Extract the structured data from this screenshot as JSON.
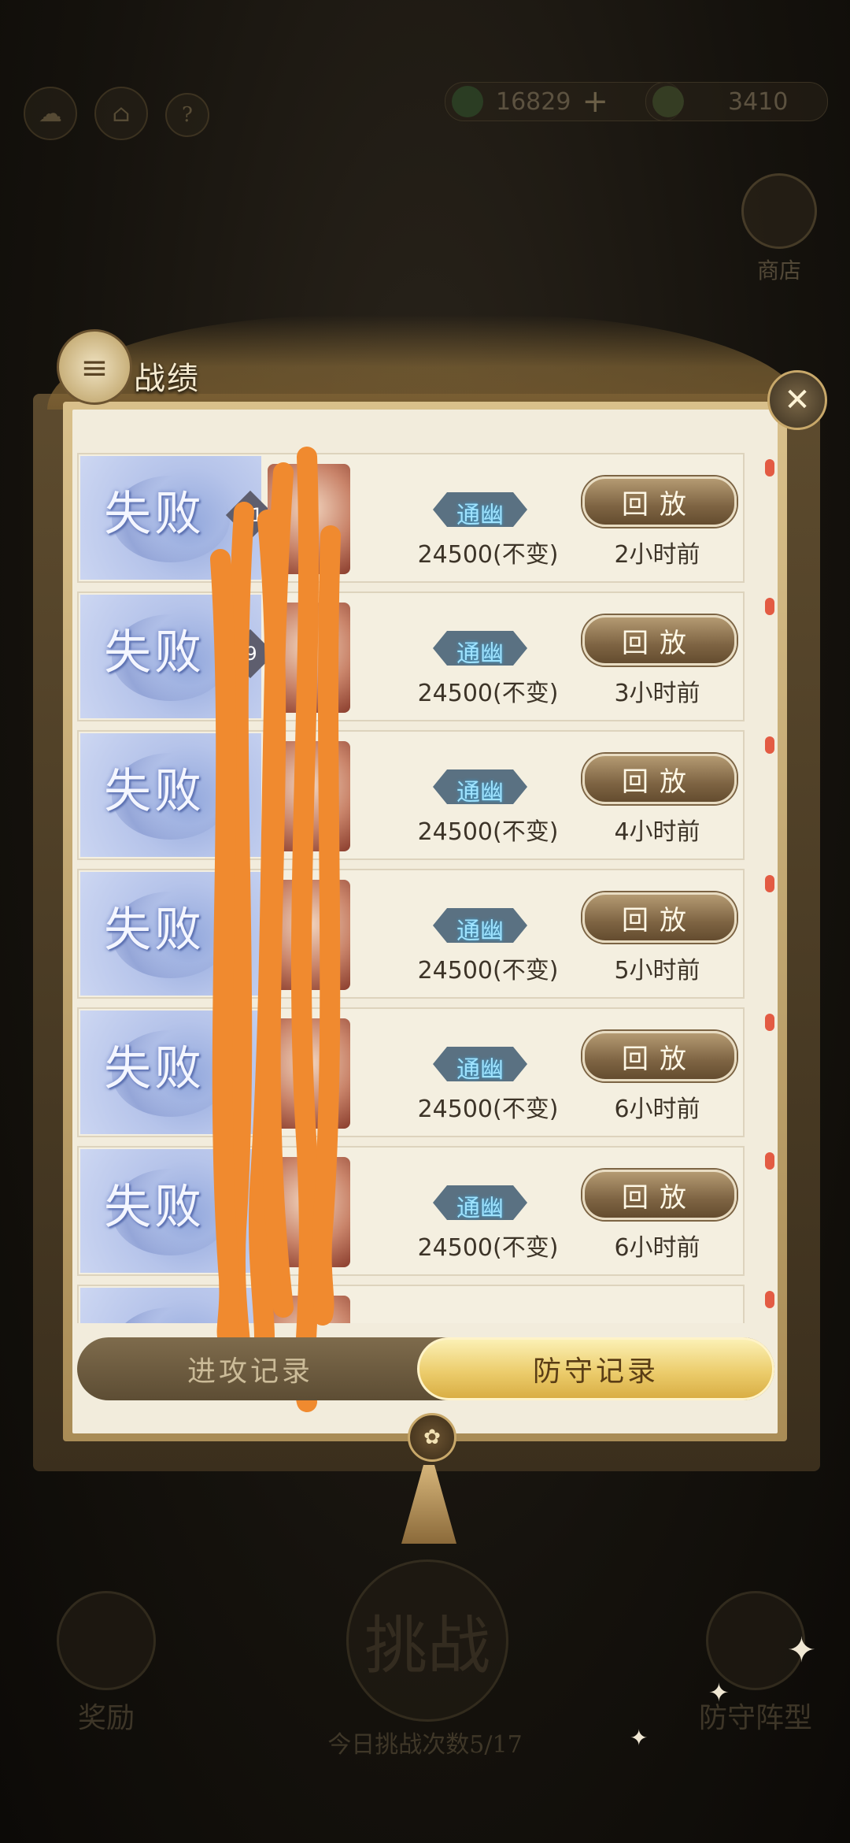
{
  "header": {
    "currency_1": "16829",
    "currency_2": "3410",
    "help_label": "?",
    "shop_label": "商店"
  },
  "panel": {
    "title": "战绩"
  },
  "records": [
    {
      "result": "失败",
      "level": "91",
      "tier": "通幽",
      "score": "24500(不变)",
      "replay": "回放",
      "time": "2小时前"
    },
    {
      "result": "失败",
      "level": "9",
      "tier": "通幽",
      "score": "24500(不变)",
      "replay": "回放",
      "time": "3小时前"
    },
    {
      "result": "失败",
      "level": "",
      "tier": "通幽",
      "score": "24500(不变)",
      "replay": "回放",
      "time": "4小时前"
    },
    {
      "result": "失败",
      "level": "",
      "tier": "通幽",
      "score": "24500(不变)",
      "replay": "回放",
      "time": "5小时前"
    },
    {
      "result": "失败",
      "level": "",
      "tier": "通幽",
      "score": "24500(不变)",
      "replay": "回放",
      "time": "6小时前"
    },
    {
      "result": "失败",
      "level": "",
      "tier": "通幽",
      "score": "24500(不变)",
      "replay": "回放",
      "time": "6小时前"
    }
  ],
  "tabs": {
    "attack": "进攻记录",
    "defense": "防守记录",
    "active": "defense"
  },
  "background": {
    "challenge": "挑战",
    "reward": "奖励",
    "lineup": "防守阵型",
    "attempts": "今日挑战次数5/17"
  }
}
